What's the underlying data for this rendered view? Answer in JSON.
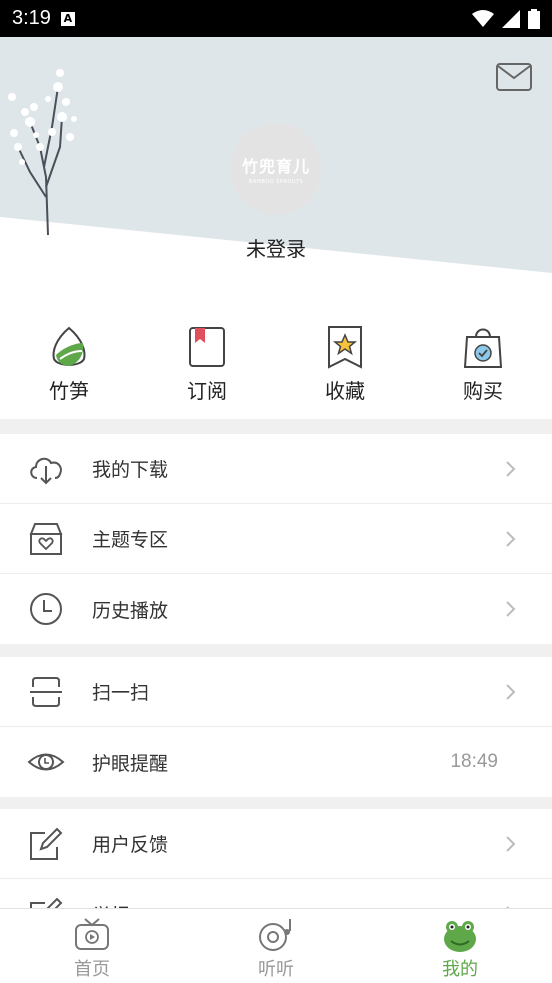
{
  "status_bar": {
    "time": "3:19",
    "a_badge": "A"
  },
  "profile": {
    "avatar_logo": "竹兜育儿",
    "avatar_sub": "BAMBOO SPROUTS",
    "login_text": "未登录"
  },
  "quick_actions": [
    {
      "label": "竹笋",
      "icon": "bamboo-shoot-icon"
    },
    {
      "label": "订阅",
      "icon": "bookmark-icon"
    },
    {
      "label": "收藏",
      "icon": "star-ribbon-icon"
    },
    {
      "label": "购买",
      "icon": "shopping-bag-icon"
    }
  ],
  "menu_group_1": [
    {
      "label": "我的下载",
      "icon": "cloud-download-icon"
    },
    {
      "label": "主题专区",
      "icon": "heart-box-icon"
    },
    {
      "label": "历史播放",
      "icon": "clock-icon"
    }
  ],
  "menu_group_2": [
    {
      "label": "扫一扫",
      "icon": "scan-icon"
    },
    {
      "label": "护眼提醒",
      "icon": "eye-icon",
      "value": "18:49"
    }
  ],
  "menu_group_3": [
    {
      "label": "用户反馈",
      "icon": "edit-icon"
    },
    {
      "label": "举报",
      "icon": "edit-icon"
    }
  ],
  "tabs": [
    {
      "label": "首页",
      "icon": "tv-icon",
      "active": false
    },
    {
      "label": "听听",
      "icon": "radio-icon",
      "active": false
    },
    {
      "label": "我的",
      "icon": "frog-icon",
      "active": true
    }
  ],
  "colors": {
    "accent": "#5fa84a",
    "hero_bg": "#dfe6ea"
  }
}
